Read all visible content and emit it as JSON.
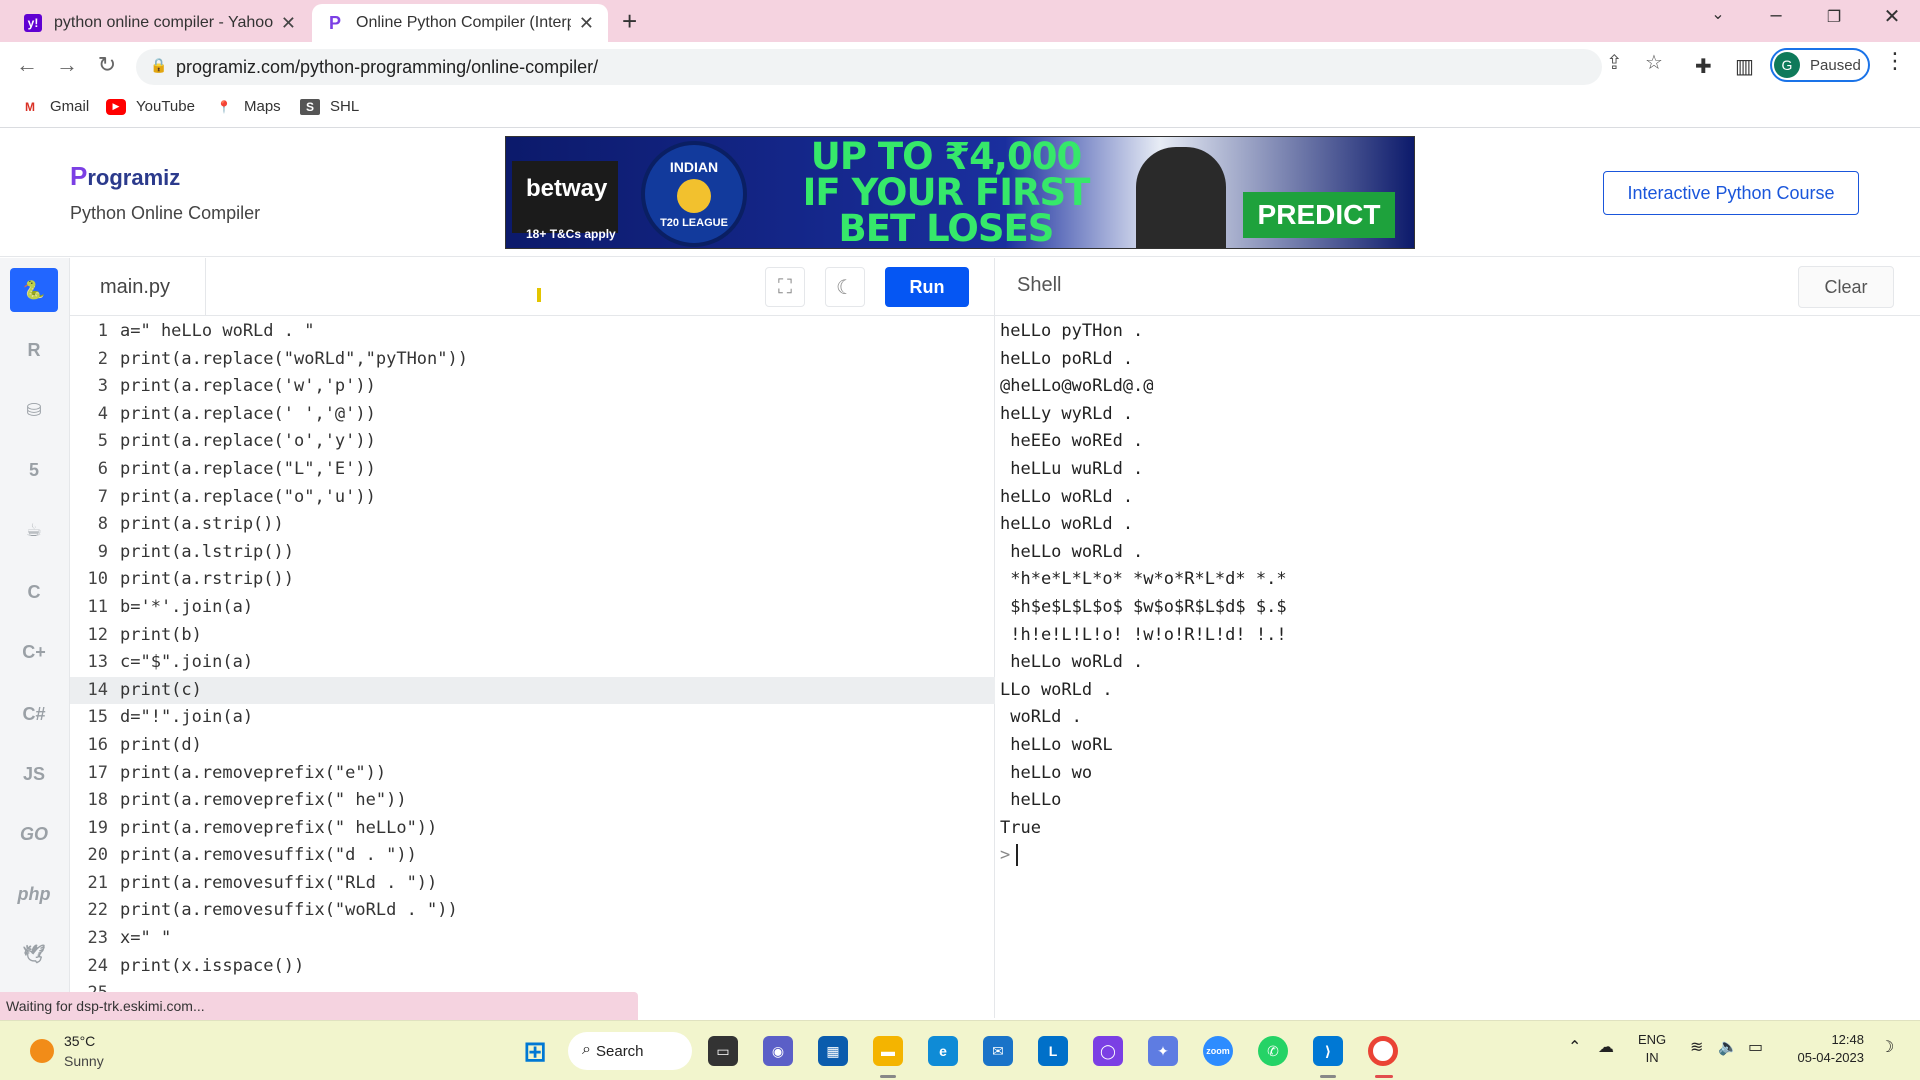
{
  "browser": {
    "tabs": [
      {
        "title": "python online compiler - Yahoo Search Results",
        "icon": "yahoo-icon",
        "active": false
      },
      {
        "title": "Online Python Compiler (Interpreter)",
        "icon": "programiz-icon",
        "active": true
      }
    ],
    "url": "programiz.com/python-programming/online-compiler/",
    "profile_status": "Paused",
    "profile_initial": "G",
    "bookmarks": [
      "Gmail",
      "YouTube",
      "Maps",
      "SHL"
    ]
  },
  "site": {
    "logo_text": "rogramiz",
    "logo_mark": "P",
    "subtitle": "Python Online Compiler",
    "course_button": "Interactive Python Course",
    "ad": {
      "brand": "betway",
      "terms": "18+ T&Cs apply",
      "badge_top": "INDIAN",
      "badge_bottom": "T20 LEAGUE",
      "headline": "UP TO ₹4,000 IF YOUR FIRST BET LOSES",
      "cta": "PREDICT"
    }
  },
  "editor": {
    "filename": "main.py",
    "run_label": "Run",
    "current_line": 14,
    "lines": [
      "a=\" heLLo woRLd . \"",
      "print(a.replace(\"woRLd\",\"pyTHon\"))",
      "print(a.replace('w','p'))",
      "print(a.replace(' ','@'))",
      "print(a.replace('o','y'))",
      "print(a.replace(\"L\",'E'))",
      "print(a.replace(\"o\",'u'))",
      "print(a.strip())",
      "print(a.lstrip())",
      "print(a.rstrip())",
      "b='*'.join(a)",
      "print(b)",
      "c=\"$\".join(a)",
      "print(c)",
      "d=\"!\".join(a)",
      "print(d)",
      "print(a.removeprefix(\"e\"))",
      "print(a.removeprefix(\" he\"))",
      "print(a.removeprefix(\" heLLo\"))",
      "print(a.removesuffix(\"d . \"))",
      "print(a.removesuffix(\"RLd . \"))",
      "print(a.removesuffix(\"woRLd . \"))",
      "x=\" \"",
      "print(x.isspace())",
      ""
    ]
  },
  "shell": {
    "title": "Shell",
    "clear_label": "Clear",
    "prompt": ">",
    "output": [
      "heLLo pyTHon .",
      "heLLo poRLd .",
      "@heLLo@woRLd@.@",
      "heLLy wyRLd .",
      " heEEo woREd .",
      " heLLu wuRLd .",
      "heLLo woRLd .",
      "heLLo woRLd .",
      " heLLo woRLd .",
      " *h*e*L*L*o* *w*o*R*L*d* *.*",
      " $h$e$L$L$o$ $w$o$R$L$d$ $.$",
      " !h!e!L!L!o! !w!o!R!L!d! !.!",
      " heLLo woRLd .",
      "LLo woRLd .",
      " woRLd .",
      " heLLo woRL",
      " heLLo wo",
      " heLLo",
      "True"
    ]
  },
  "rail": {
    "items": [
      "python-icon",
      "r-icon",
      "sql-icon",
      "html-icon",
      "java-icon",
      "c-icon",
      "cpp-icon",
      "csharp-icon",
      "JS",
      "GO",
      "php",
      "swift-icon"
    ]
  },
  "status_bar": "Waiting for dsp-trk.eskimi.com...",
  "taskbar": {
    "temperature": "35°C",
    "condition": "Sunny",
    "search_label": "Search",
    "lang_top": "ENG",
    "lang_bottom": "IN",
    "time": "12:48",
    "date": "05-04-2023"
  },
  "colors": {
    "accent": "#0556f3",
    "tabbar": "#f5d3e0",
    "taskbar": "#f2f5cd"
  }
}
